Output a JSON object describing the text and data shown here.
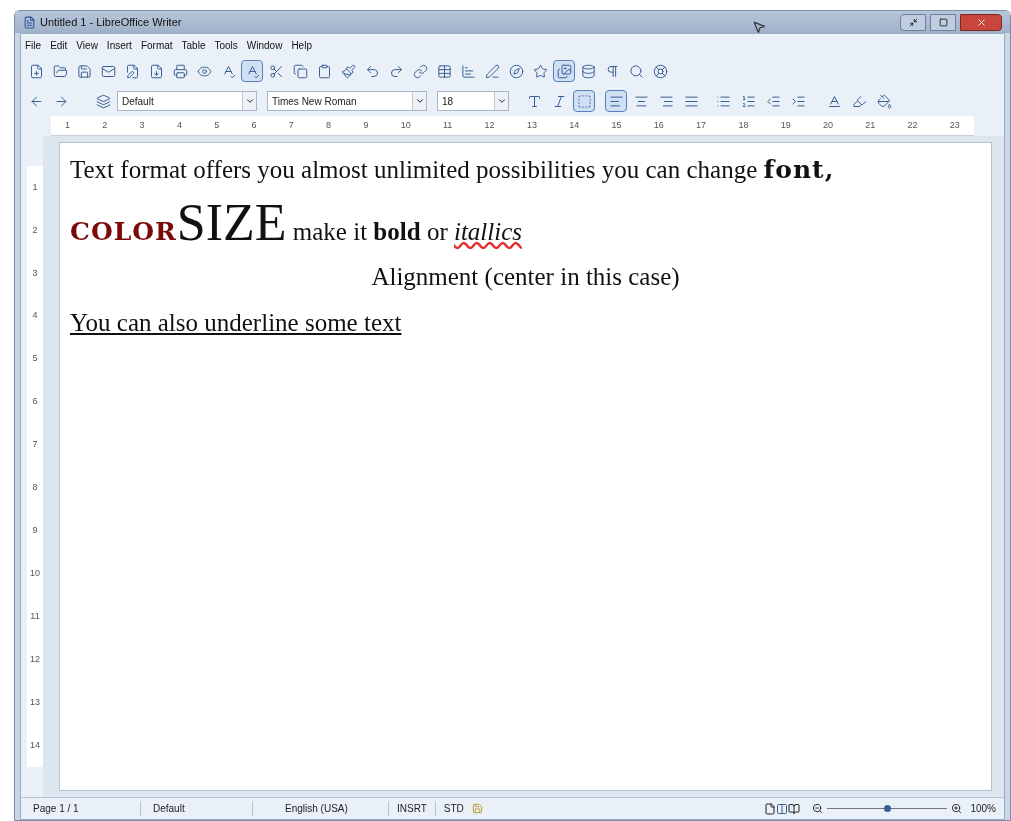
{
  "window": {
    "title": "Untitled 1 - LibreOffice Writer"
  },
  "menu": [
    "File",
    "Edit",
    "View",
    "Insert",
    "Format",
    "Table",
    "Tools",
    "Window",
    "Help"
  ],
  "format_bar": {
    "paragraph_style": "Default",
    "font_name": "Times New Roman",
    "font_size": "18",
    "alignment_buttons": [
      {
        "selected": true
      },
      {
        "selected": false
      },
      {
        "selected": false
      },
      {
        "selected": false
      }
    ]
  },
  "ruler": {
    "horizontal": [
      "1",
      "2",
      "3",
      "4",
      "5",
      "6",
      "7",
      "8",
      "9",
      "10",
      "11",
      "12",
      "13",
      "14",
      "15",
      "16",
      "17",
      "18",
      "19",
      "20",
      "21",
      "22",
      "23"
    ],
    "vertical": [
      "1",
      "2",
      "3",
      "4",
      "5",
      "6",
      "7",
      "8",
      "9",
      "10",
      "11",
      "12",
      "13",
      "14"
    ]
  },
  "document": {
    "paragraphs": [
      {
        "centered": false,
        "runs": [
          {
            "kind": "plain",
            "text": "Text format offers you almost unlimited possibilities you can change "
          },
          {
            "kind": "wide",
            "text": "font,"
          }
        ]
      },
      {
        "centered": false,
        "runs": [
          {
            "kind": "wide",
            "text": "COLOR",
            "color": "#7a0a0a"
          },
          {
            "kind": "large",
            "text": "SIZE"
          },
          {
            "kind": "plain",
            "text": " make it "
          },
          {
            "kind": "bold",
            "text": "bold"
          },
          {
            "kind": "plain",
            "text": " or "
          },
          {
            "kind": "italic",
            "text": "itallics",
            "misspelled": true
          }
        ]
      },
      {
        "centered": true,
        "runs": [
          {
            "kind": "plain",
            "text": "Alignment (center in this case)"
          }
        ]
      },
      {
        "centered": false,
        "runs": [
          {
            "kind": "underline",
            "text": "You can also underline some text"
          }
        ]
      }
    ]
  },
  "status_bar": {
    "page": "Page 1 / 1",
    "page_style": "Default",
    "language": "English (USA)",
    "insert_mode": "INSRT",
    "selection_mode": "STD",
    "zoom": {
      "level": 0.5,
      "reading": "100%"
    }
  }
}
